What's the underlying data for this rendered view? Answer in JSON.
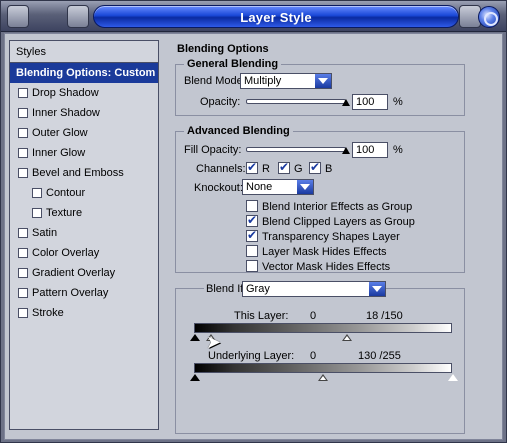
{
  "window": {
    "title": "Layer Style"
  },
  "styles": {
    "header": "Styles",
    "items": [
      {
        "label": "Blending Options: Custom",
        "selected": true,
        "sub": false
      },
      {
        "label": "Drop Shadow",
        "selected": false,
        "sub": false
      },
      {
        "label": "Inner Shadow",
        "selected": false,
        "sub": false
      },
      {
        "label": "Outer Glow",
        "selected": false,
        "sub": false
      },
      {
        "label": "Inner Glow",
        "selected": false,
        "sub": false
      },
      {
        "label": "Bevel and Emboss",
        "selected": false,
        "sub": false
      },
      {
        "label": "Contour",
        "selected": false,
        "sub": true
      },
      {
        "label": "Texture",
        "selected": false,
        "sub": true
      },
      {
        "label": "Satin",
        "selected": false,
        "sub": false
      },
      {
        "label": "Color Overlay",
        "selected": false,
        "sub": false
      },
      {
        "label": "Gradient Overlay",
        "selected": false,
        "sub": false
      },
      {
        "label": "Pattern Overlay",
        "selected": false,
        "sub": false
      },
      {
        "label": "Stroke",
        "selected": false,
        "sub": false
      }
    ]
  },
  "blending": {
    "title": "Blending Options",
    "general": {
      "title": "General Blending",
      "blend_mode_label": "Blend Mode:",
      "blend_mode_value": "Multiply",
      "opacity_label": "Opacity:",
      "opacity_value": "100",
      "opacity_unit": "%",
      "opacity_fraction": 1.0
    },
    "advanced": {
      "title": "Advanced Blending",
      "fill_opacity_label": "Fill Opacity:",
      "fill_opacity_value": "100",
      "fill_opacity_unit": "%",
      "fill_opacity_fraction": 1.0,
      "channels_label": "Channels:",
      "channels": [
        {
          "label": "R",
          "checked": true
        },
        {
          "label": "G",
          "checked": true
        },
        {
          "label": "B",
          "checked": true
        }
      ],
      "knockout_label": "Knockout:",
      "knockout_value": "None",
      "options": [
        {
          "label": "Blend Interior Effects as Group",
          "checked": false
        },
        {
          "label": "Blend Clipped Layers as Group",
          "checked": true
        },
        {
          "label": "Transparency Shapes Layer",
          "checked": true
        },
        {
          "label": "Layer Mask Hides Effects",
          "checked": false
        },
        {
          "label": "Vector Mask Hides Effects",
          "checked": false
        }
      ]
    },
    "blend_if": {
      "label": "Blend If:",
      "value": "Gray",
      "this_layer": {
        "label": "This Layer:",
        "low": "0",
        "high": "18 /150"
      },
      "underlying_layer": {
        "label": "Underlying Layer:",
        "low": "0",
        "high": "130 /255"
      }
    }
  }
}
